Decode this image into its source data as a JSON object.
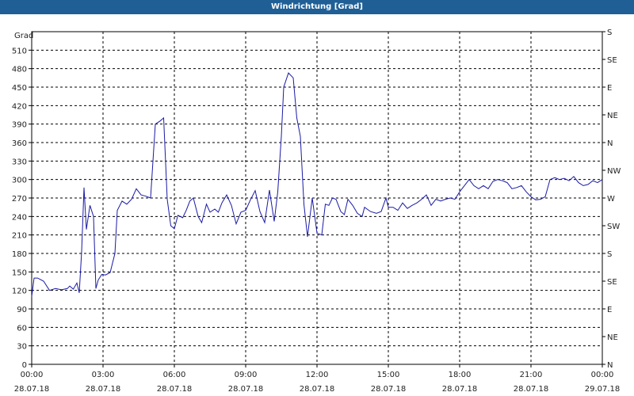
{
  "window": {
    "title": "Windrichtung [Grad]"
  },
  "chart_data": {
    "type": "line",
    "title": "Windrichtung [Grad]",
    "ylabel": "Grad",
    "ylim": [
      0,
      540
    ],
    "xlim": [
      "28.07.18 00:00",
      "29.07.18 00:00"
    ],
    "grid": true,
    "y_ticks": [
      0,
      30,
      60,
      90,
      120,
      150,
      180,
      210,
      240,
      270,
      300,
      330,
      360,
      390,
      420,
      450,
      480,
      510
    ],
    "x_ticks": [
      {
        "time": "00:00",
        "date": "28.07.18"
      },
      {
        "time": "03:00",
        "date": "28.07.18"
      },
      {
        "time": "06:00",
        "date": "28.07.18"
      },
      {
        "time": "09:00",
        "date": "28.07.18"
      },
      {
        "time": "12:00",
        "date": "28.07.18"
      },
      {
        "time": "15:00",
        "date": "28.07.18"
      },
      {
        "time": "18:00",
        "date": "28.07.18"
      },
      {
        "time": "21:00",
        "date": "28.07.18"
      },
      {
        "time": "00:00",
        "date": "29.07.18"
      }
    ],
    "compass_labels": [
      "N",
      "NE",
      "E",
      "SE",
      "S",
      "SW",
      "W",
      "NW",
      "N",
      "NE",
      "E",
      "SE",
      "S"
    ],
    "series": [
      {
        "color": "#1a1aa6",
        "hours": [
          0.0,
          0.1,
          0.25,
          0.5,
          0.75,
          1.0,
          1.25,
          1.5,
          1.6,
          1.75,
          1.9,
          2.0,
          2.1,
          2.2,
          2.3,
          2.45,
          2.6,
          2.7,
          2.8,
          2.95,
          3.1,
          3.3,
          3.5,
          3.6,
          3.8,
          4.0,
          4.2,
          4.4,
          4.6,
          4.8,
          5.0,
          5.2,
          5.4,
          5.55,
          5.7,
          5.85,
          6.0,
          6.15,
          6.35,
          6.5,
          6.65,
          6.8,
          7.0,
          7.15,
          7.35,
          7.5,
          7.7,
          7.85,
          8.0,
          8.2,
          8.4,
          8.6,
          8.8,
          9.0,
          9.2,
          9.4,
          9.6,
          9.8,
          10.0,
          10.2,
          10.35,
          10.5,
          10.6,
          10.8,
          11.0,
          11.15,
          11.3,
          11.45,
          11.6,
          11.8,
          12.0,
          12.2,
          12.35,
          12.5,
          12.65,
          12.8,
          13.0,
          13.15,
          13.3,
          13.5,
          13.7,
          13.9,
          14.0,
          14.25,
          14.5,
          14.7,
          14.9,
          15.0,
          15.2,
          15.4,
          15.6,
          15.8,
          16.0,
          16.2,
          16.4,
          16.6,
          16.8,
          17.0,
          17.2,
          17.4,
          17.6,
          17.8,
          18.0,
          18.2,
          18.4,
          18.6,
          18.8,
          19.0,
          19.2,
          19.4,
          19.6,
          19.8,
          20.0,
          20.2,
          20.4,
          20.6,
          20.8,
          21.0,
          21.2,
          21.4,
          21.6,
          21.8,
          22.0,
          22.2,
          22.4,
          22.6,
          22.8,
          23.0,
          23.2,
          23.4,
          23.6,
          23.8,
          24.0
        ],
        "values": [
          110,
          140,
          140,
          135,
          120,
          123,
          121,
          123,
          127,
          122,
          132,
          116,
          183,
          287,
          219,
          258,
          240,
          123,
          137,
          146,
          145,
          149,
          180,
          250,
          265,
          260,
          268,
          285,
          275,
          273,
          270,
          390,
          395,
          400,
          268,
          225,
          220,
          242,
          238,
          250,
          265,
          270,
          240,
          230,
          260,
          247,
          252,
          247,
          262,
          275,
          258,
          228,
          247,
          250,
          267,
          282,
          248,
          230,
          283,
          232,
          280,
          370,
          450,
          473,
          465,
          400,
          370,
          260,
          207,
          270,
          213,
          210,
          260,
          258,
          270,
          268,
          248,
          243,
          268,
          258,
          245,
          240,
          255,
          248,
          245,
          248,
          270,
          255,
          255,
          250,
          262,
          253,
          258,
          262,
          268,
          275,
          258,
          268,
          265,
          268,
          270,
          268,
          280,
          290,
          300,
          290,
          285,
          290,
          285,
          297,
          300,
          298,
          295,
          285,
          287,
          290,
          280,
          272,
          267,
          268,
          272,
          300,
          303,
          300,
          302,
          298,
          305,
          295,
          290,
          292,
          298,
          295,
          300,
          307
        ]
      }
    ]
  }
}
